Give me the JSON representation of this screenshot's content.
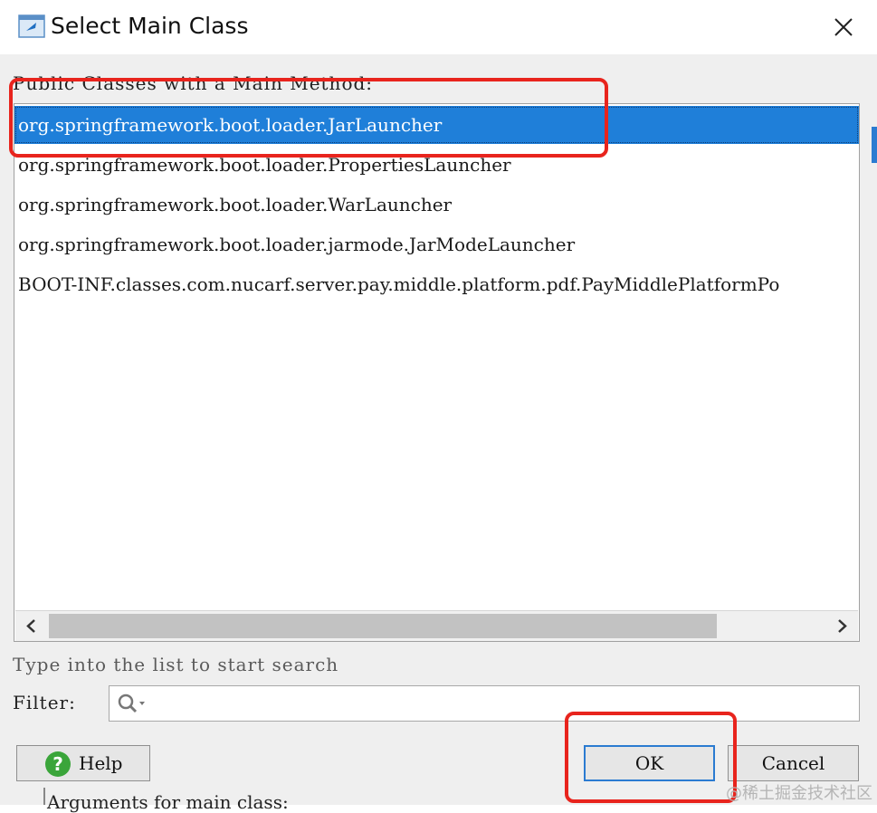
{
  "window": {
    "title": "Select Main Class"
  },
  "list": {
    "caption": "Public Classes with a Main Method:",
    "items": [
      {
        "label": "org.springframework.boot.loader.JarLauncher",
        "selected": true
      },
      {
        "label": "org.springframework.boot.loader.PropertiesLauncher",
        "selected": false
      },
      {
        "label": "org.springframework.boot.loader.WarLauncher",
        "selected": false
      },
      {
        "label": "org.springframework.boot.loader.jarmode.JarModeLauncher",
        "selected": false
      },
      {
        "label": "BOOT-INF.classes.com.nucarf.server.pay.middle.platform.pdf.PayMiddlePlatformPo",
        "selected": false
      }
    ]
  },
  "search": {
    "hint": "Type into the list to start search",
    "filter_label": "Filter:",
    "filter_value": ""
  },
  "buttons": {
    "help": "Help",
    "ok": "OK",
    "cancel": "Cancel"
  },
  "background_text": "Arguments for main class:",
  "watermark": "@稀土掘金技术社区",
  "colors": {
    "selection": "#1f7fd9",
    "annotation": "#e8241d",
    "help_icon": "#3aa53a",
    "ok_border": "#2b7bd1"
  },
  "icons": {
    "app": "window-app-icon",
    "close": "close-icon",
    "search": "search-icon",
    "help": "help-icon",
    "scroll_left": "chevron-left-icon",
    "scroll_right": "chevron-right-icon"
  }
}
